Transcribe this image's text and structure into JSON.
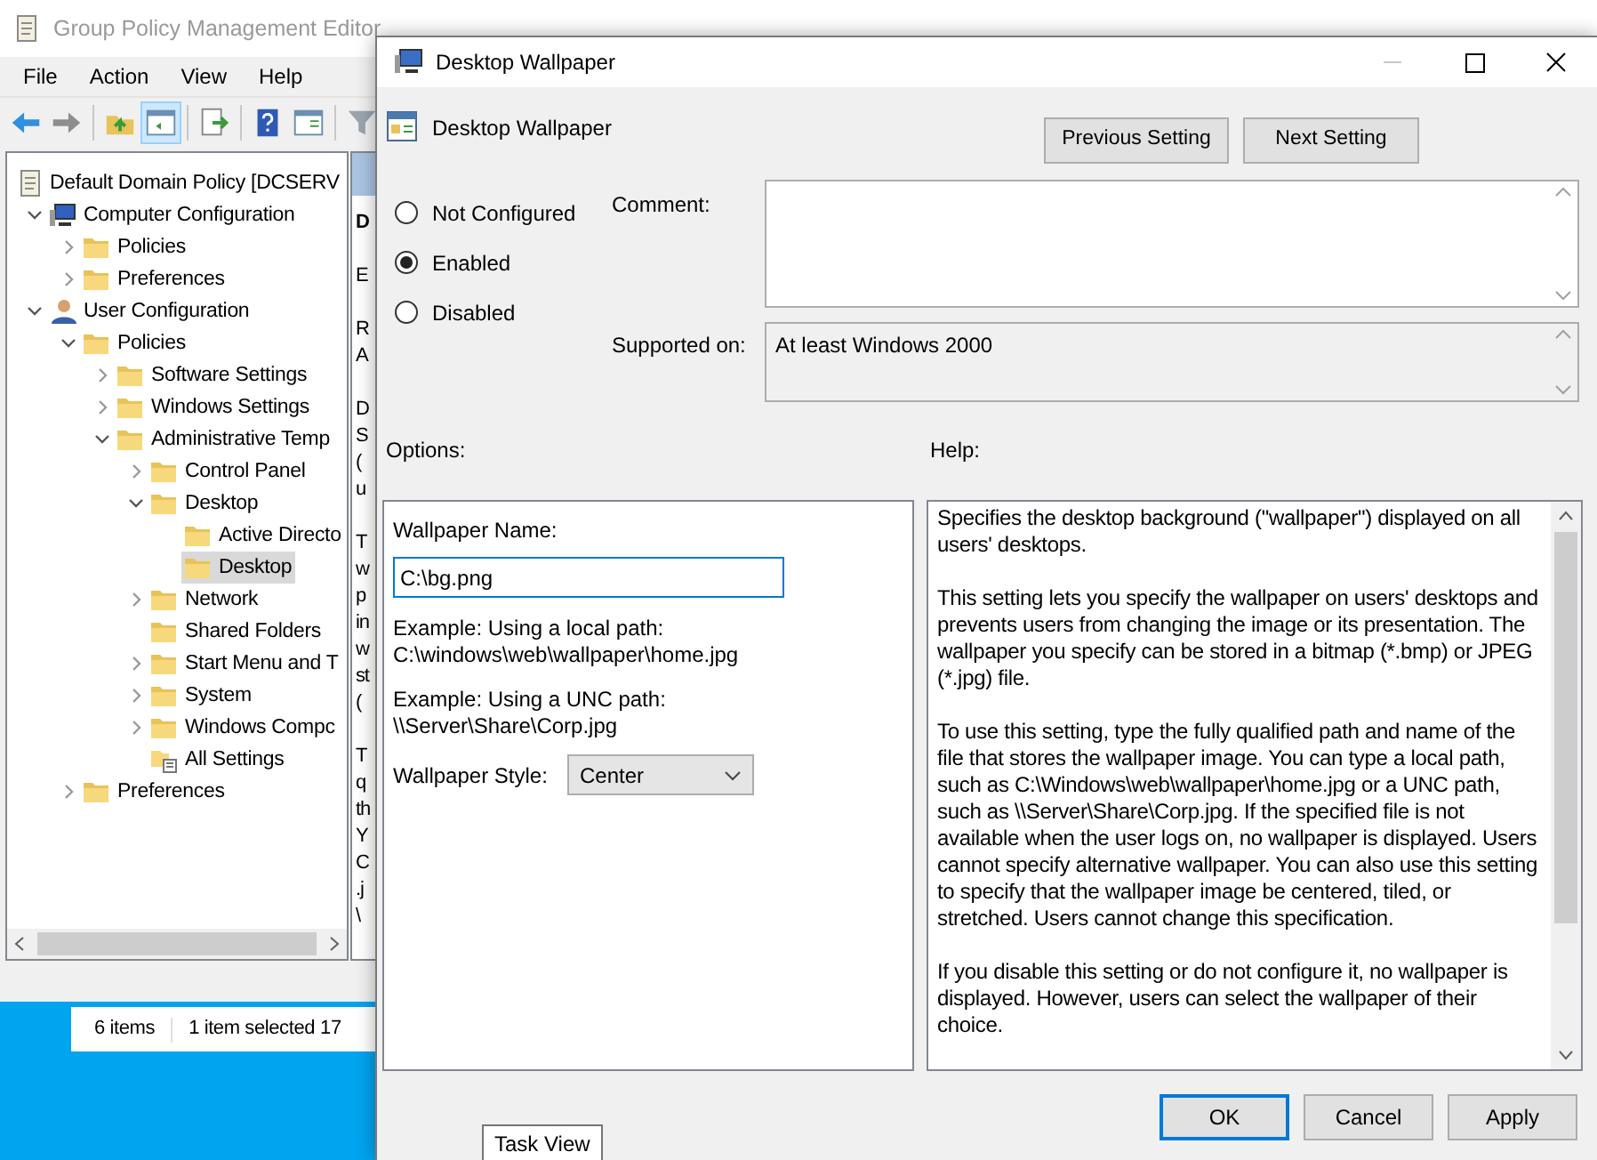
{
  "background_window": {
    "title": "Group Policy Management Editor",
    "menu": [
      "File",
      "Action",
      "View",
      "Help"
    ],
    "toolbar": [
      {
        "kind": "back",
        "selected": false
      },
      {
        "kind": "forward",
        "selected": false
      },
      {
        "kind": "separator"
      },
      {
        "kind": "up",
        "selected": false
      },
      {
        "kind": "pane",
        "selected": true
      },
      {
        "kind": "separator"
      },
      {
        "kind": "export",
        "selected": false
      },
      {
        "kind": "separator"
      },
      {
        "kind": "help",
        "selected": false
      },
      {
        "kind": "properties",
        "selected": false
      },
      {
        "kind": "separator"
      },
      {
        "kind": "filter",
        "selected": false
      }
    ],
    "tree": [
      {
        "label": "Default Domain Policy [DCSERV",
        "kind": "policy",
        "selected": false,
        "children": [
          {
            "label": "Computer Configuration",
            "kind": "computer",
            "expanded": true,
            "selected": false,
            "children": [
              {
                "label": "Policies",
                "kind": "folder",
                "expanded": false,
                "selected": false
              },
              {
                "label": "Preferences",
                "kind": "folder",
                "expanded": false,
                "selected": false
              }
            ]
          },
          {
            "label": "User Configuration",
            "kind": "user",
            "expanded": true,
            "selected": false,
            "children": [
              {
                "label": "Policies",
                "kind": "folder",
                "expanded": true,
                "selected": false,
                "children": [
                  {
                    "label": "Software Settings",
                    "kind": "folder",
                    "expanded": false,
                    "selected": false
                  },
                  {
                    "label": "Windows Settings",
                    "kind": "folder",
                    "expanded": false,
                    "selected": false
                  },
                  {
                    "label": "Administrative Temp",
                    "kind": "folder",
                    "expanded": true,
                    "selected": false,
                    "children": [
                      {
                        "label": "Control Panel",
                        "kind": "folder",
                        "expanded": false,
                        "selected": false
                      },
                      {
                        "label": "Desktop",
                        "kind": "folder",
                        "expanded": true,
                        "selected": false,
                        "children": [
                          {
                            "label": "Active Directo",
                            "kind": "folder",
                            "selected": false
                          },
                          {
                            "label": "Desktop",
                            "kind": "folder",
                            "selected": true
                          }
                        ]
                      },
                      {
                        "label": "Network",
                        "kind": "folder",
                        "expanded": false,
                        "selected": false
                      },
                      {
                        "label": "Shared Folders",
                        "kind": "folder",
                        "selected": false
                      },
                      {
                        "label": "Start Menu and T",
                        "kind": "folder",
                        "expanded": false,
                        "selected": false
                      },
                      {
                        "label": "System",
                        "kind": "folder",
                        "expanded": false,
                        "selected": false
                      },
                      {
                        "label": "Windows Compc",
                        "kind": "folder",
                        "expanded": false,
                        "selected": false
                      },
                      {
                        "label": "All Settings",
                        "kind": "settings",
                        "selected": false
                      }
                    ]
                  }
                ]
              },
              {
                "label": "Preferences",
                "kind": "folder",
                "expanded": false,
                "selected": false
              }
            ]
          }
        ]
      }
    ],
    "detail_fragments": [
      {
        "kind": "heading",
        "lines": [
          "D"
        ]
      },
      {
        "kind": "text",
        "lines": [
          "E"
        ]
      },
      {
        "kind": "text",
        "lines": [
          "R",
          "A"
        ]
      },
      {
        "kind": "text",
        "lines": [
          "D",
          "S",
          "(",
          "u"
        ]
      },
      {
        "kind": "text",
        "lines": [
          "T",
          "w",
          "p",
          "in",
          "w",
          "st",
          "("
        ]
      },
      {
        "kind": "text",
        "lines": [
          "T",
          "q",
          "th",
          "Y",
          "C",
          ".j",
          "\\"
        ]
      }
    ]
  },
  "status_bar": [
    "6 items",
    "1 item selected",
    "17"
  ],
  "dialog": {
    "title": "Desktop Wallpaper",
    "setting_name": "Desktop Wallpaper",
    "nav_buttons": [
      "Previous Setting",
      "Next Setting"
    ],
    "states": [
      {
        "label": "Not Configured",
        "selected": false
      },
      {
        "label": "Enabled",
        "selected": true
      },
      {
        "label": "Disabled",
        "selected": false
      }
    ],
    "comment": {
      "label": "Comment:"
    },
    "supported_on": {
      "label": "Supported on:",
      "value": "At least Windows 2000"
    },
    "options_label": "Options:",
    "help_label": "Help:",
    "options": {
      "name_label": "Wallpaper Name:",
      "name_value": "C:\\bg.png",
      "examples": [
        [
          "Example: Using a local path:",
          "C:\\windows\\web\\wallpaper\\home.jpg"
        ],
        [
          "Example: Using a UNC path:",
          "\\\\Server\\Share\\Corp.jpg"
        ]
      ],
      "style_label": "Wallpaper Style:",
      "style_value": "Center"
    },
    "help": [
      "Specifies the desktop background (\"wallpaper\") displayed on all users' desktops.",
      "This setting lets you specify the wallpaper on users' desktops and prevents users from changing the image or its presentation. The wallpaper you specify can be stored in a bitmap (*.bmp) or JPEG (*.jpg) file.",
      "To use this setting, type the fully qualified path and name of the file that stores the wallpaper image. You can type a local path, such as C:\\Windows\\web\\wallpaper\\home.jpg or a UNC path, such as \\\\Server\\Share\\Corp.jpg. If the specified file is not available when the user logs on, no wallpaper is displayed. Users cannot specify alternative wallpaper. You can also use this setting to specify that the wallpaper image be centered, tiled, or stretched. Users cannot change this specification.",
      "If you disable this setting or do not configure it, no wallpaper is displayed. However, users can select the wallpaper of their choice."
    ],
    "buttons": [
      {
        "label": "OK",
        "default": true
      },
      {
        "label": "Cancel",
        "default": false
      },
      {
        "label": "Apply",
        "default": false
      }
    ]
  },
  "tooltip": "Task View"
}
